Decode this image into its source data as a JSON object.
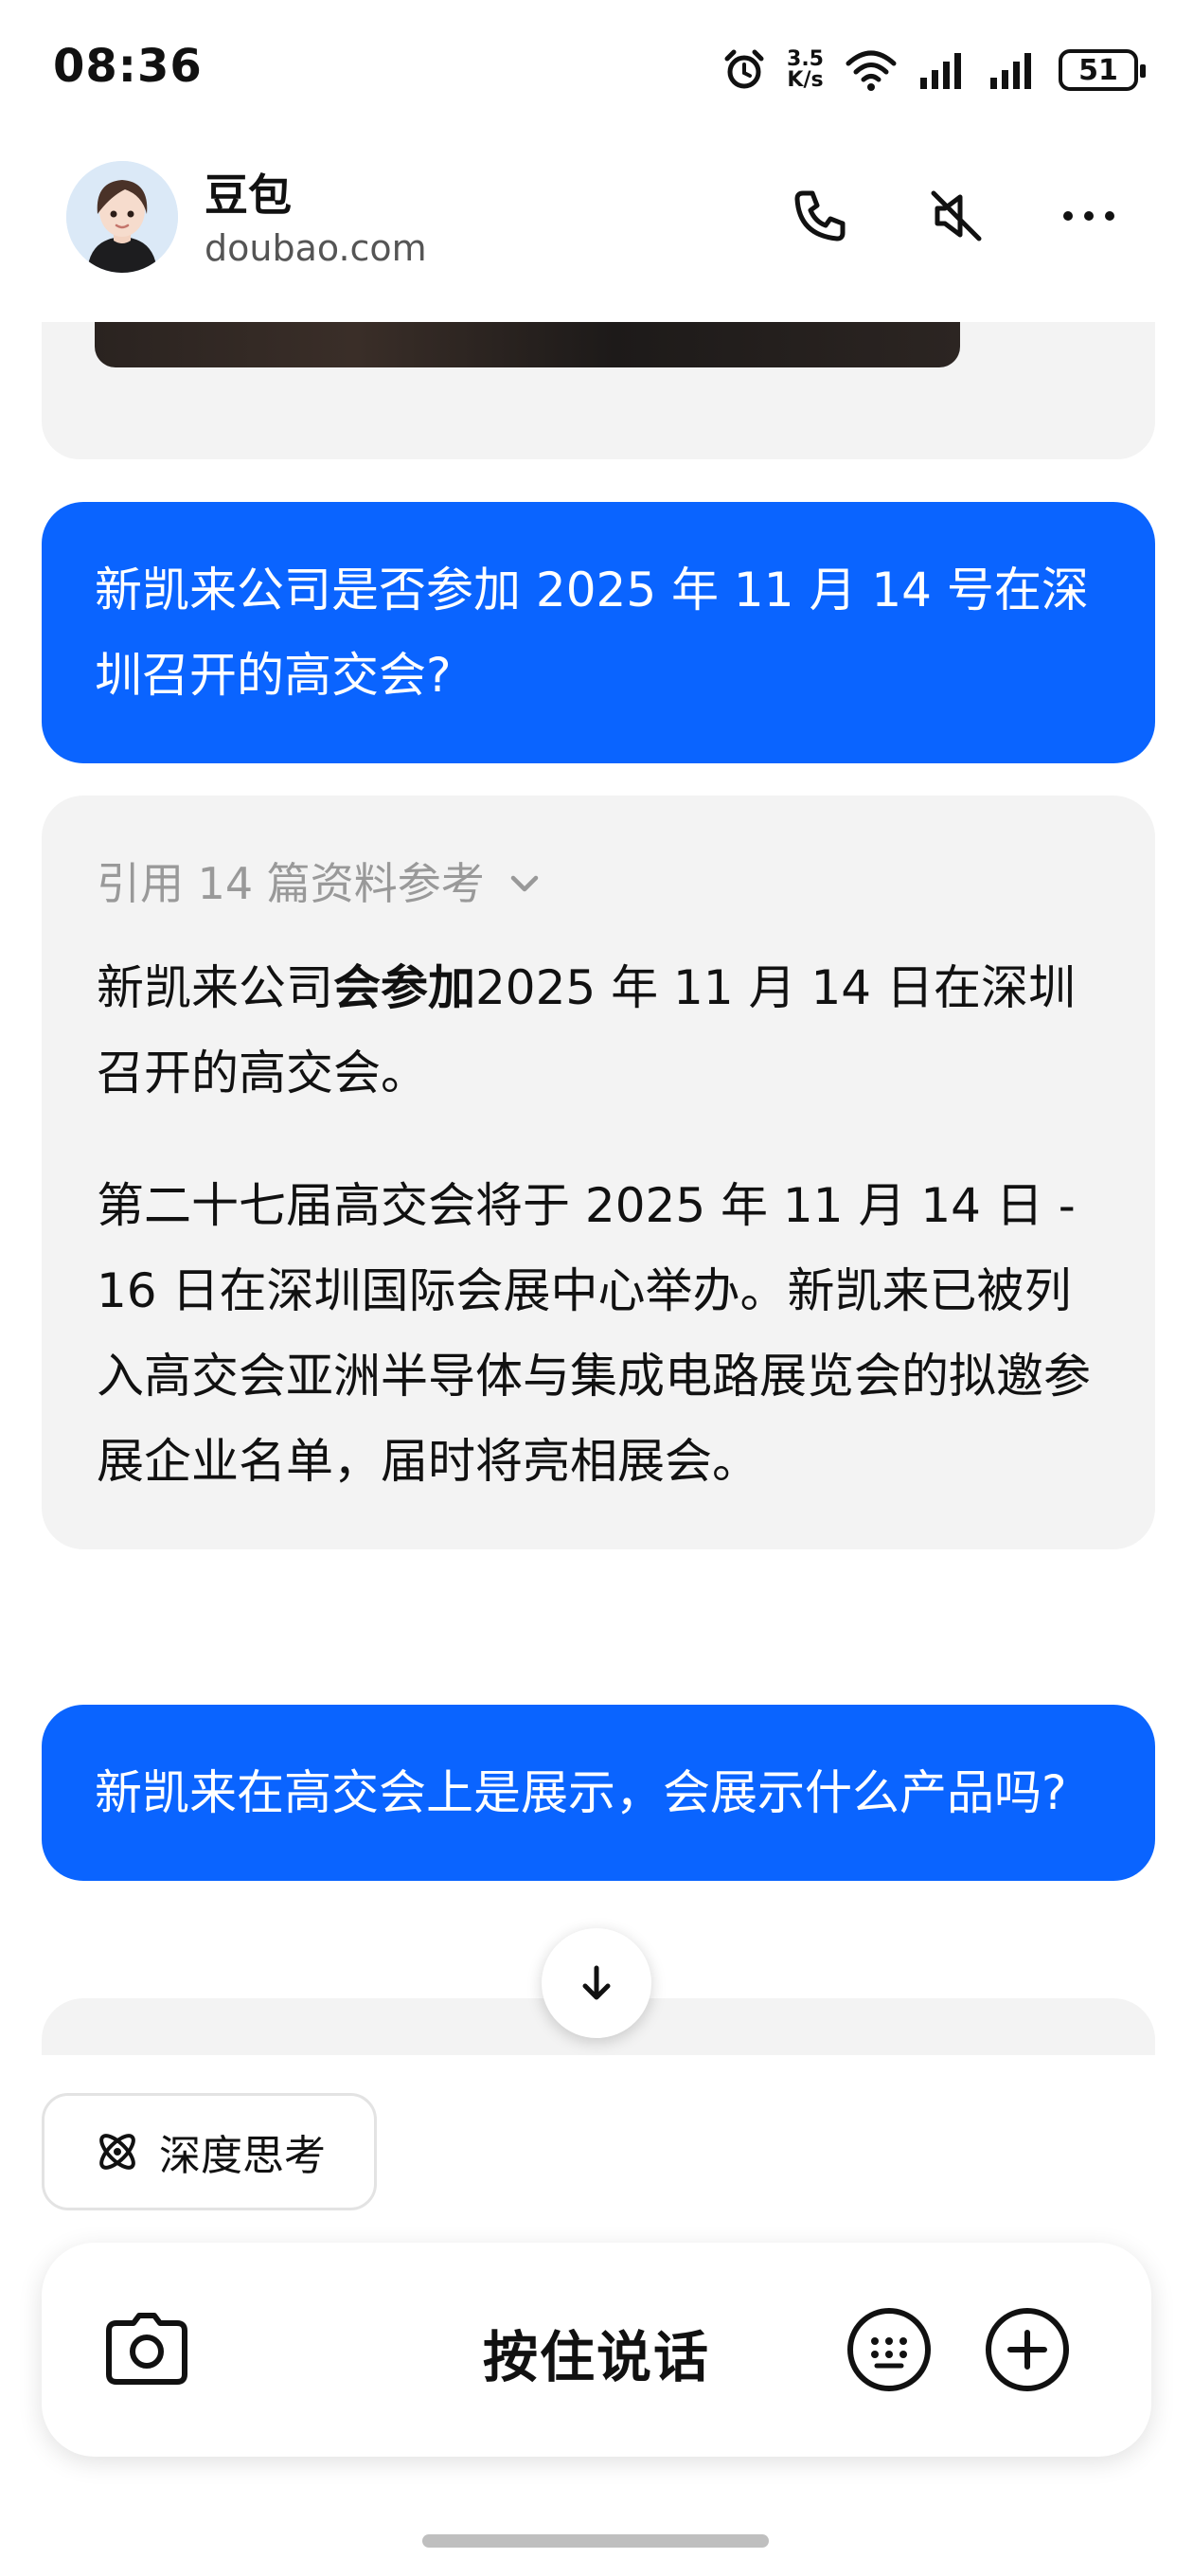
{
  "status_bar": {
    "time": "08:36",
    "net_speed_value": "3.5",
    "net_speed_unit": "K/s",
    "battery": "51"
  },
  "header": {
    "name": "豆包",
    "domain": "doubao.com"
  },
  "messages": {
    "user_1": "新凯来公司是否参加 2025 年 11 月 14 号在深圳召开的高交会?",
    "ai_1": {
      "references": "引用 14 篇资料参考",
      "p1_prefix": "新凯来公司",
      "p1_bold": "会参加",
      "p1_suffix": "2025 年 11 月 14 日在深圳召开的高交会。",
      "p2": "第二十七届高交会将于 2025 年 11 月 14 日 - 16 日在深圳国际会展中心举办。新凯来已被列入高交会亚洲半导体与集成电路展览会的拟邀参展企业名单，届时将亮相展会。"
    },
    "user_2": "新凯来在高交会上是展示，会展示什么产品吗?"
  },
  "chips": {
    "deep_think": "深度思考"
  },
  "input_bar": {
    "hold_to_talk": "按住说话"
  },
  "icons": {
    "call": "phone-icon",
    "mute": "speaker-muted-icon",
    "more": "more-dots-icon",
    "camera": "camera-icon",
    "keyboard": "keyboard-icon",
    "plus": "plus-icon",
    "scroll": "arrow-down-icon",
    "deep_think": "atom-icon"
  },
  "colors": {
    "accent": "#0a64ff",
    "bubble_gray": "#f3f3f3",
    "muted_text": "#999999"
  }
}
